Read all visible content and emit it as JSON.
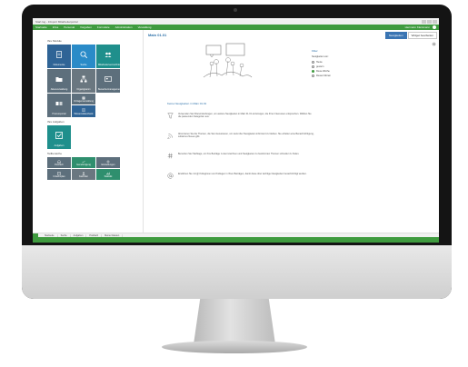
{
  "window": {
    "title": "Start.log - Infoport Mitarbeiterportal"
  },
  "menu": {
    "items": [
      "Startseite",
      "Infos",
      "Personal",
      "Vorgaben",
      "Formulare",
      "Administration",
      "Verwaltung"
    ],
    "user": "Hermann Kleinmann"
  },
  "left": {
    "section1": "Ihre Module",
    "section2": "Teilbereiche",
    "section3": "Ihre Aufgaben",
    "tiles": [
      {
        "label": "Dokumente",
        "color": "#2f6496",
        "icon": "document-icon"
      },
      {
        "label": "Suche",
        "color": "#2a8bc8",
        "icon": "search-icon"
      },
      {
        "label": "Mitarbeiterverzeichnis",
        "color": "#1f8f8c",
        "icon": "people-icon"
      },
      {
        "label": "Aktenverwaltung",
        "color": "#5d6f7c",
        "icon": "folder-icon"
      },
      {
        "label": "Organigramm",
        "color": "#6a7780",
        "icon": "org-icon"
      },
      {
        "label": "Bewerbermanagement",
        "color": "#5d6f7c",
        "icon": "contact-icon"
      },
      {
        "label": "Prozessportal",
        "color": "#5d6f7c",
        "icon": "process-icon"
      },
      {
        "label": "Vorlagenverwaltung",
        "color": "#5d6f7c",
        "icon": "template-icon"
      },
      {
        "label": "Wissensdatenbank",
        "color": "#2f6496",
        "icon": "book-icon"
      }
    ],
    "tasks_tile": {
      "label": "Aufgaben",
      "color": "#1f8f8c",
      "icon": "checkbox-icon"
    },
    "bottom_tiles": [
      {
        "label": "Postfach",
        "color": "#5d6f7c",
        "icon": "inbox-icon"
      },
      {
        "label": "Genehmigung",
        "color": "#2f8f6e",
        "icon": "check-icon"
      },
      {
        "label": "Einstellungen",
        "color": "#5d6f7c",
        "icon": "settings-icon"
      },
      {
        "label": "Urlaubsplan",
        "color": "#5d6f7c",
        "icon": "calendar-icon"
      },
      {
        "label": "Kalender",
        "color": "#6a7780",
        "icon": "person-icon"
      },
      {
        "label": "Statistik",
        "color": "#2f8f6e",
        "icon": "chart-icon"
      }
    ]
  },
  "main": {
    "title": "Main 01.01",
    "btn_new": "Neuigkeiten",
    "btn_edit": "Widget bearbeiten",
    "news_title": "Keine Neuigkeiten in Main 01.01",
    "items": [
      {
        "icon": "filter-icon",
        "text": "Verwenden Sie Filtereinstellungen, um weitere Neuigkeiten in Main 01.01 anzuzeigen, die Ihren Interessen entsprechen. Wählen Sie die passenden Kategorien aus."
      },
      {
        "icon": "feed-icon",
        "text": "Abonnieren Sie die Themen, die Sie interessieren, um stets über Neuigkeiten informiert zu bleiben. Sie erhalten eine Benachrichtigung, sobald es Neues gibt."
      },
      {
        "icon": "hashtag-icon",
        "text": "Benutzen Sie Hashtags, um Ihre Beiträge zu kennzeichnen und Neuigkeiten zu bestimmten Themen schneller zu finden."
      },
      {
        "icon": "mention-icon",
        "text": "Erwähnen Sie mit @ Kolleginnen und Kollegen in Ihren Beiträgen, damit diese über wichtige Neuigkeiten benachrichtigt werden."
      }
    ]
  },
  "filter": {
    "title": "Filter",
    "subtitle": "Neuigkeiten von:",
    "options": [
      "Heute",
      "gestern",
      "Diese Woche",
      "Diesen Monat"
    ],
    "selected": 2
  },
  "taskbar": {
    "items": [
      "Startseite",
      "Suche",
      "Aufgaben",
      "Postfach",
      "Meine Dateien"
    ]
  },
  "colors": {
    "menu": "#3f9b3f",
    "link": "#2a6fa8"
  }
}
